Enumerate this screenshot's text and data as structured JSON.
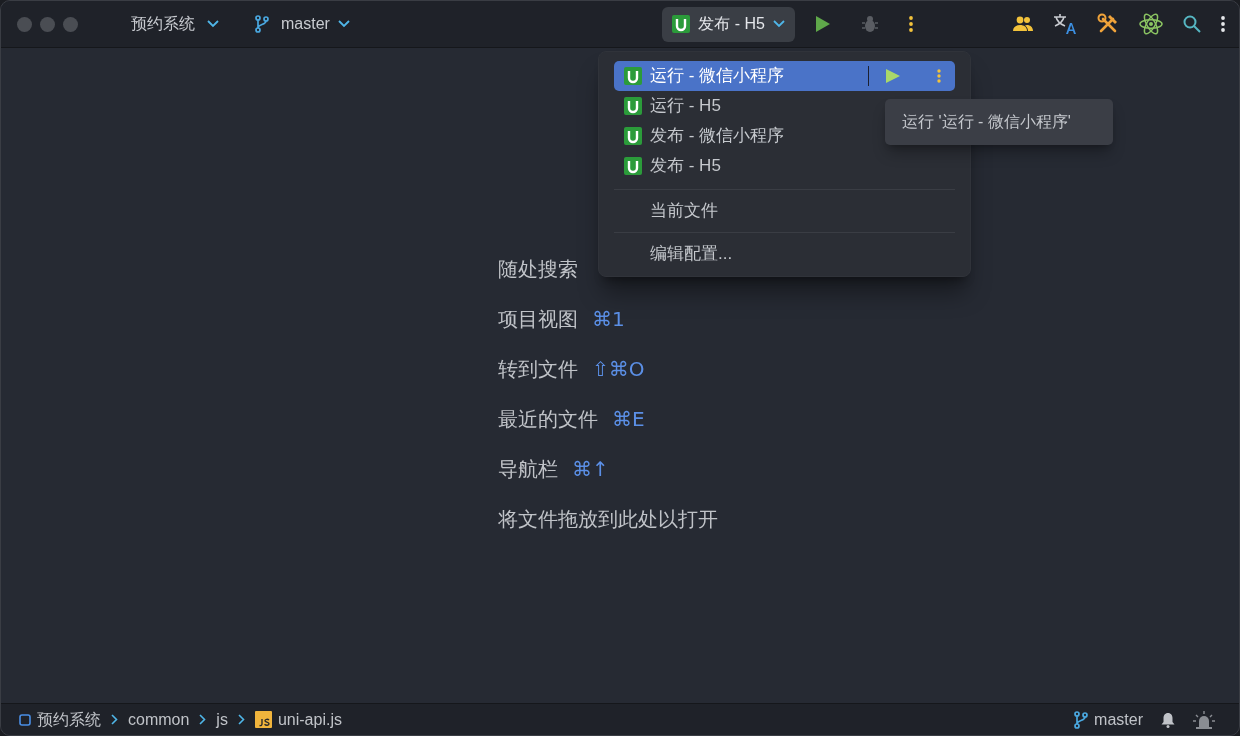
{
  "window": {
    "project": "预约系统",
    "branch": "master"
  },
  "toolbar": {
    "run_config": "发布 - H5"
  },
  "run_menu": {
    "configs": [
      {
        "label": "运行 - 微信小程序",
        "selected": true
      },
      {
        "label": "运行 - H5",
        "selected": false
      },
      {
        "label": "发布 - 微信小程序",
        "selected": false
      },
      {
        "label": "发布 - H5",
        "selected": false
      }
    ],
    "items": [
      "当前文件",
      "编辑配置..."
    ]
  },
  "tooltip": "运行 '运行 - 微信小程序'",
  "hints": [
    {
      "label": "随处搜索"
    },
    {
      "label": "项目视图",
      "shortcut": "⌘1"
    },
    {
      "label": "转到文件",
      "shortcut": "⇧⌘O"
    },
    {
      "label": "最近的文件",
      "shortcut": "⌘E"
    },
    {
      "label": "导航栏",
      "shortcut": "⌘↑"
    },
    {
      "label": "将文件拖放到此处以打开"
    }
  ],
  "status_bar": {
    "breadcrumbs": [
      {
        "label": "预约系统",
        "kind": "module"
      },
      {
        "label": "common",
        "kind": "folder"
      },
      {
        "label": "js",
        "kind": "folder"
      },
      {
        "label": "uni-api.js",
        "kind": "js-file"
      }
    ],
    "branch": "master"
  }
}
